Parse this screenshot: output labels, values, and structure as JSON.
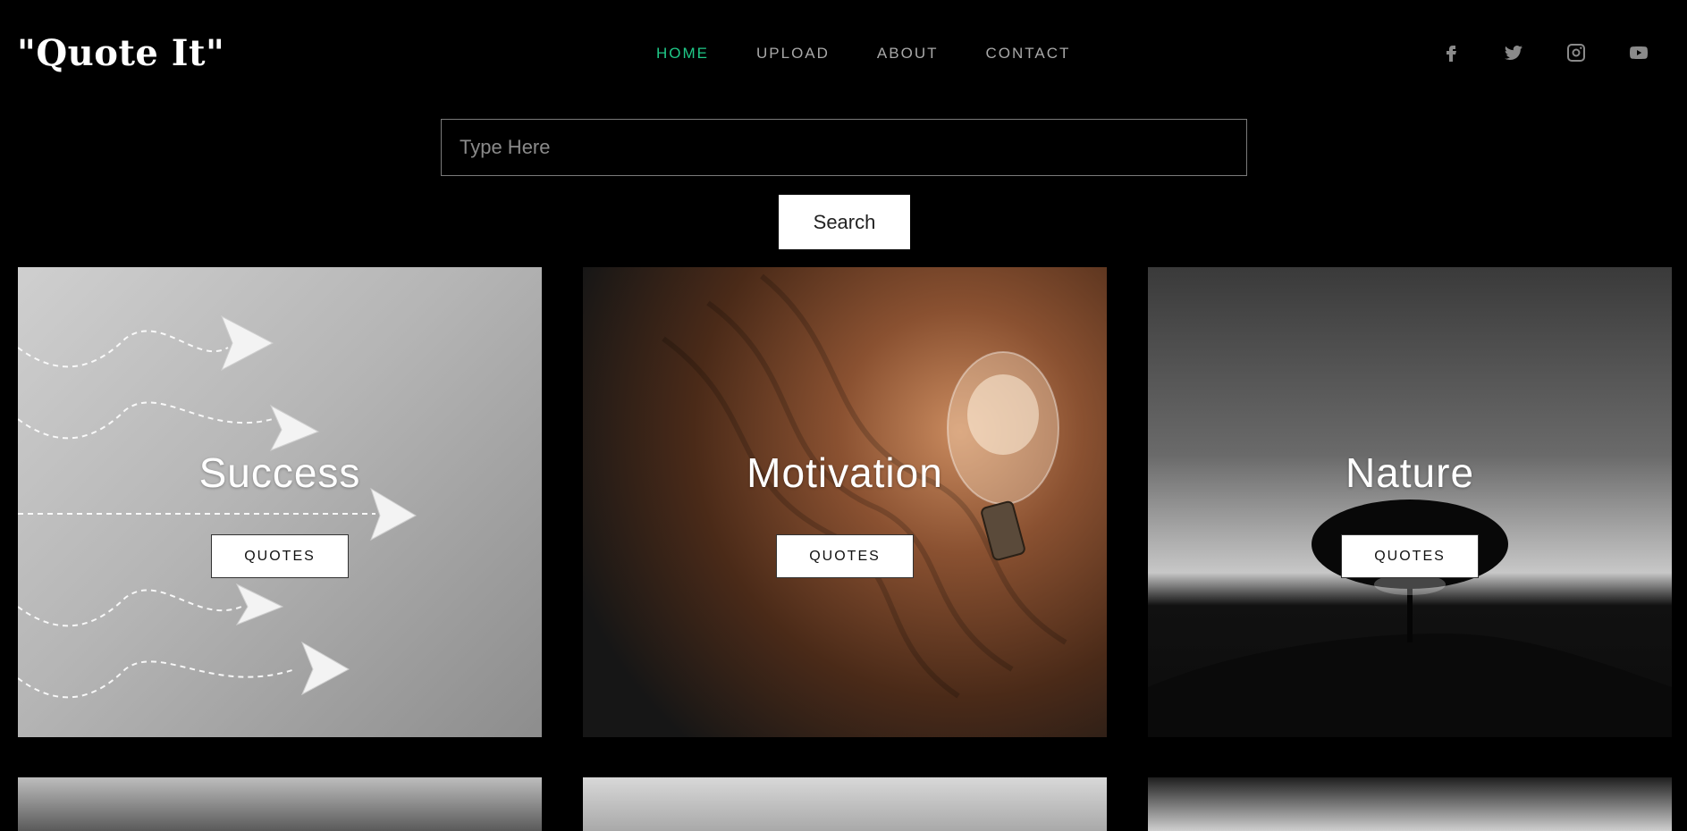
{
  "header": {
    "logo": "\"Quote It\"",
    "nav": [
      {
        "label": "HOME",
        "active": true
      },
      {
        "label": "UPLOAD",
        "active": false
      },
      {
        "label": "ABOUT",
        "active": false
      },
      {
        "label": "CONTACT",
        "active": false
      }
    ],
    "social": [
      "facebook-icon",
      "twitter-icon",
      "instagram-icon",
      "youtube-icon"
    ]
  },
  "search": {
    "placeholder": "Type Here",
    "button_label": "Search"
  },
  "categories": [
    {
      "title": "Success",
      "button": "QUOTES"
    },
    {
      "title": "Motivation",
      "button": "QUOTES"
    },
    {
      "title": "Nature",
      "button": "QUOTES"
    }
  ],
  "colors": {
    "accent": "#1fc887",
    "background": "#000000"
  }
}
